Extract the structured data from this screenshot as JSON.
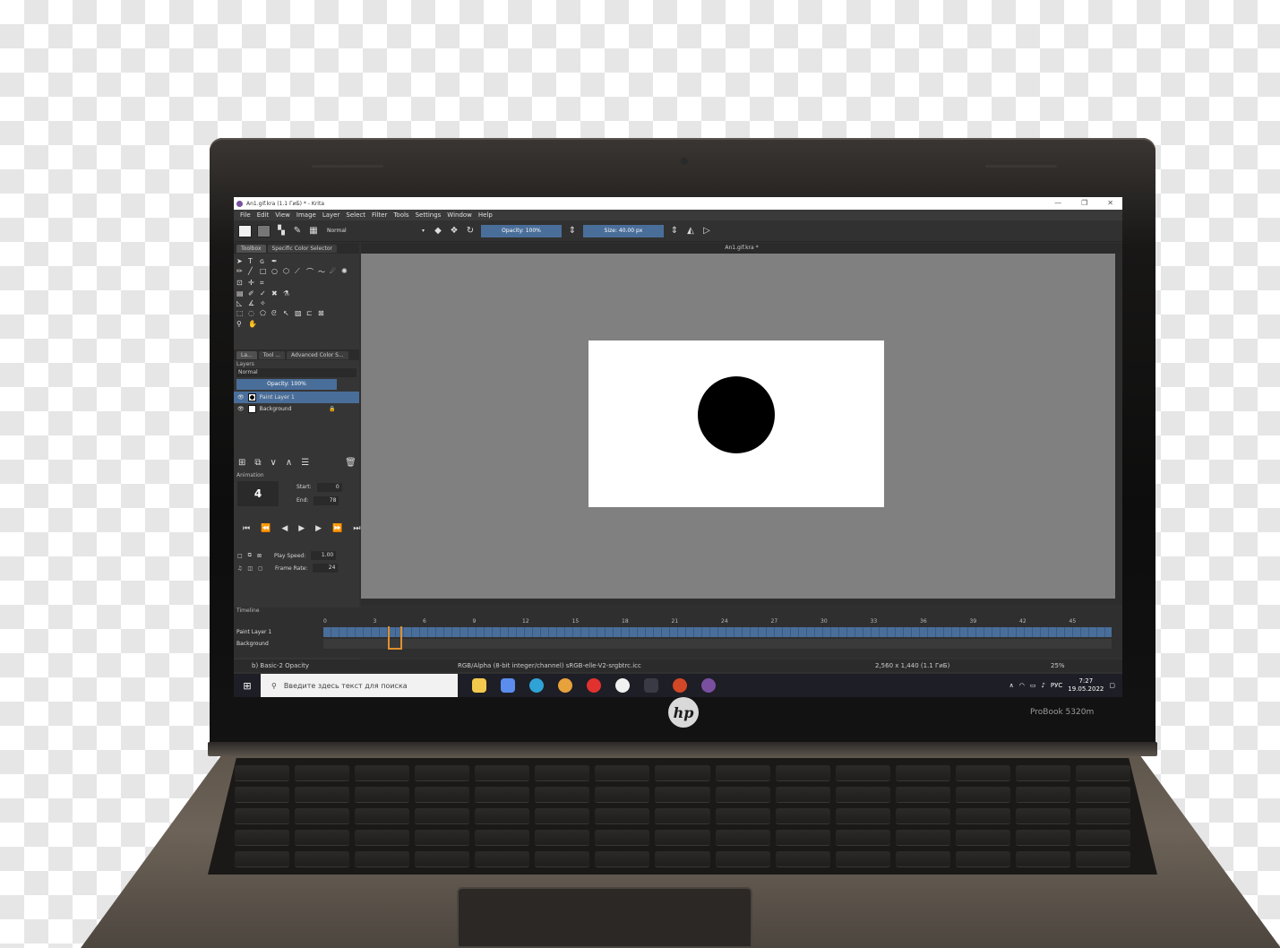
{
  "window": {
    "title": "An1.gif.kra (1.1 ГиБ)  * - Krita",
    "minimize": "—",
    "maximize": "❐",
    "close": "✕"
  },
  "menu": [
    "File",
    "Edit",
    "View",
    "Image",
    "Layer",
    "Select",
    "Filter",
    "Tools",
    "Settings",
    "Window",
    "Help"
  ],
  "toolbar": {
    "blend_mode": "Normal",
    "opacity": "Opacity: 100%",
    "size": "Size: 40.00 px"
  },
  "docker_tabs": [
    "Toolbox",
    "Specific Color Selector"
  ],
  "layer_docker_tabs": [
    "La...",
    "Tool ...",
    "Advanced Color S..."
  ],
  "layers": {
    "title": "Layers",
    "blend": "Normal",
    "opacity": "Opacity:  100%",
    "items": [
      {
        "name": "Paint Layer 1",
        "selected": true
      },
      {
        "name": "Background",
        "selected": false
      }
    ]
  },
  "animation": {
    "title": "Animation",
    "current_frame": "4",
    "start_label": "Start:",
    "start_value": "0",
    "end_label": "End:",
    "end_value": "78",
    "play_speed_label": "Play Speed:",
    "play_speed_value": "1.00",
    "frame_rate_label": "Frame Rate:",
    "frame_rate_value": "24"
  },
  "canvas": {
    "tab_title": "An1.gif.kra *"
  },
  "timeline": {
    "title": "Timeline",
    "ruler": [
      "0",
      "3",
      "6",
      "9",
      "12",
      "15",
      "18",
      "21",
      "24",
      "27",
      "30",
      "33",
      "36",
      "39",
      "42",
      "45"
    ],
    "rows": [
      "Paint Layer 1",
      "Background"
    ]
  },
  "status": {
    "brush": "b) Basic-2 Opacity",
    "color": "RGB/Alpha (8-bit integer/channel)  sRGB-elle-V2-srgbtrc.icc",
    "size": "2,560 x 1,440 (1.1 ГиБ)",
    "zoom": "25%"
  },
  "taskbar": {
    "search_placeholder": "Введите здесь текст для поиска",
    "language": "РУС",
    "time": "7:27",
    "date": "19.05.2022"
  },
  "laptop": {
    "brand": "hp",
    "model": "ProBook 5320m"
  },
  "colors": {
    "accent": "#4a6e9a",
    "canvas_bg": "#808080",
    "timeline_cursor": "#e0902e"
  }
}
